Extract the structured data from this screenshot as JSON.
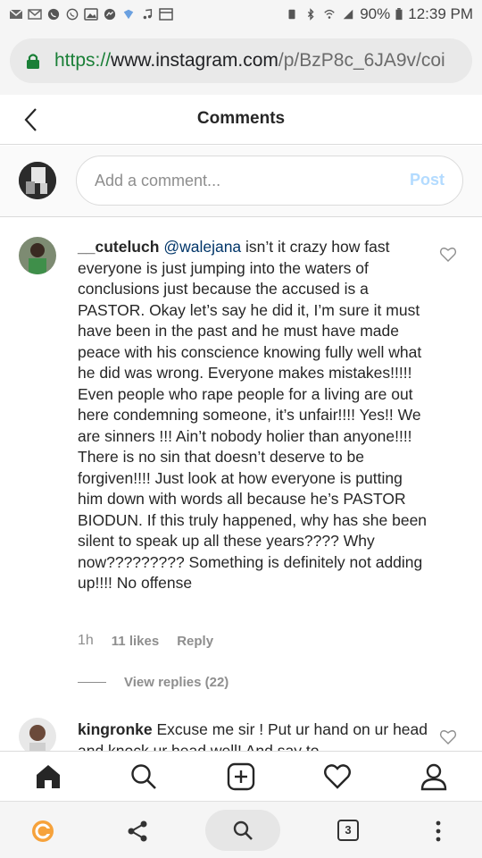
{
  "status_bar": {
    "battery": "90%",
    "time": "12:39 PM"
  },
  "browser": {
    "url_scheme": "https://",
    "url_host": "www.instagram.com",
    "url_path": "/p/BzP8c_6JA9v/coi",
    "tabs_count": "3"
  },
  "header": {
    "title": "Comments"
  },
  "compose": {
    "placeholder": "Add a comment...",
    "post_label": "Post"
  },
  "comments": [
    {
      "username": "__cuteluch",
      "mention": "@walejana",
      "text": " isn’t it crazy how fast everyone is just jumping into the waters of conclusions just because the accused is a PASTOR. Okay let’s say he did it, I’m sure it must have been in the past and he must have made peace with his conscience knowing fully well what he did was wrong. Everyone makes mistakes!!!!! Even people who rape people for a living are out here condemning someone, it’s unfair!!!! Yes!! We are sinners !!! Ain’t nobody holier than anyone!!!! There is no sin that doesn’t deserve to be forgiven!!!! Just look at how everyone is putting him down with words all because he’s PASTOR BIODUN. If this truly happened, why has she been silent to speak up all these years???? Why now????????? Something is definitely not adding up!!!! No offense",
      "time": "1h",
      "likes": "11 likes",
      "reply": "Reply",
      "view_replies": "View replies (22)"
    },
    {
      "username": "kingronke",
      "text": " Excuse me sir ! Put ur hand on ur head and knock ur head well! And say to"
    }
  ],
  "colors": {
    "accent_blue": "#3897f0",
    "post_disabled": "#b3dbff",
    "mention": "#003569",
    "secure_green": "#1a7f37"
  }
}
